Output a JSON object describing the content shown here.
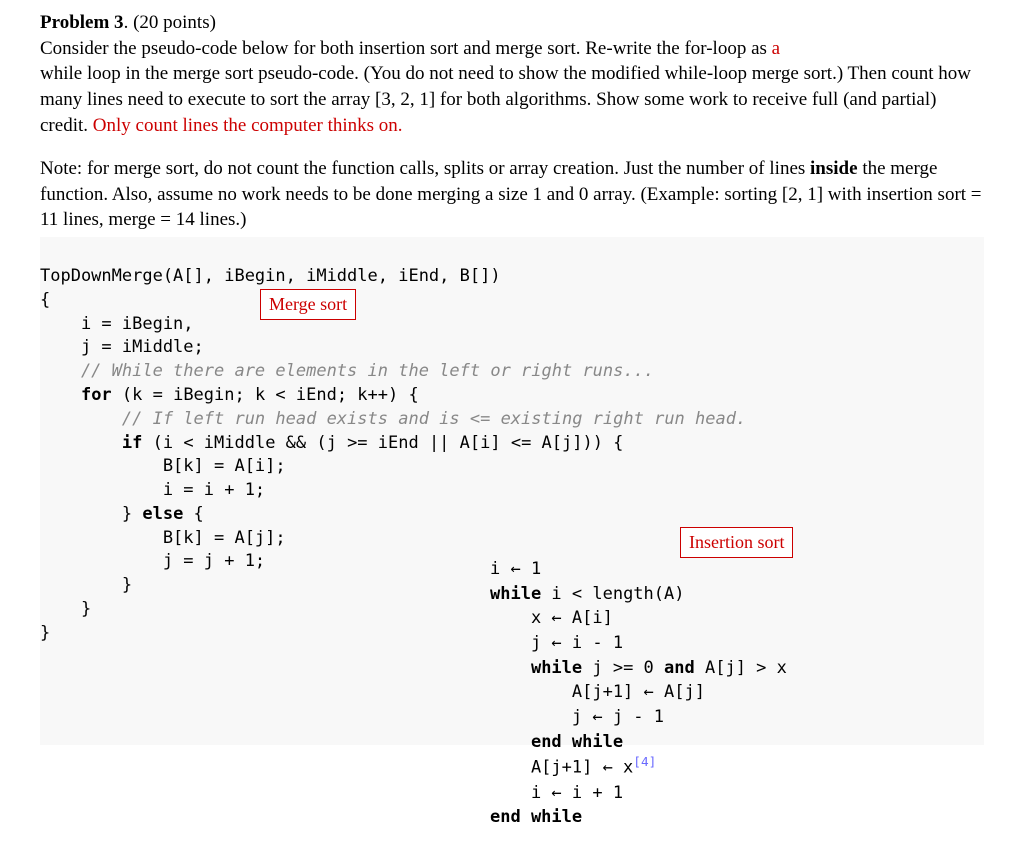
{
  "problem": {
    "title_bold": "Problem 3",
    "title_rest": ". (20 points)",
    "para1_a": "Consider the pseudo-code below for both insertion sort and merge sort.  Re-write the for-loop as ",
    "para1_red": "a",
    "para1_b": "while loop in the merge sort pseudo-code.  (You do not need to show the modified while-loop merge sort.)   Then count how many lines need to execute to sort the array [3, 2, 1] for both algorithms.  Show some work to receive full (and partial) credit.  ",
    "para1_red2": "Only count lines the computer thinks on.",
    "para2_a": "Note: for merge sort, do not count the function calls, splits or array creation.  Just the number of lines ",
    "para2_bold": "inside",
    "para2_b": " the merge function.  Also, assume no work needs to be done merging a size 1 and 0 array.  (Example: sorting [2, 1] with insertion sort = 11 lines, merge = 14 lines.)"
  },
  "annotations": {
    "merge_label": "Merge sort",
    "insertion_label": "Insertion sort"
  },
  "merge_code": {
    "l1": "TopDownMerge(A[], iBegin, iMiddle, iEnd, B[])",
    "l2": "{",
    "l3": "    i = iBegin,",
    "l4": "    j = iMiddle;",
    "l5": "    // While there are elements in the left or right runs...",
    "l6a": "    ",
    "l6_for": "for",
    "l6b": " (k = iBegin; k < iEnd; k++) {",
    "l7": "        // If left run head exists and is <= existing right run head.",
    "l8a": "        ",
    "l8_if": "if",
    "l8b": " (i < iMiddle && (j >= iEnd || A[i] <= A[j])) {",
    "l9": "            B[k] = A[i];",
    "l10": "            i = i + 1;",
    "l11a": "        } ",
    "l11_else": "else",
    "l11b": " {",
    "l12": "            B[k] = A[j];",
    "l13": "            j = j + 1;",
    "l14": "        }",
    "l15": "    }",
    "l16": "}"
  },
  "insertion_code": {
    "l1": "i ← 1",
    "l2a": "while",
    "l2b": " i < length(A)",
    "l3": "    x ← A[i]",
    "l4": "    j ← i - 1",
    "l5a": "    ",
    "l5_while": "while",
    "l5b": " j >= 0 ",
    "l5_and": "and",
    "l5c": " A[j] > x",
    "l6": "        A[j+1] ← A[j]",
    "l7": "        j ← j - 1",
    "l8a": "    ",
    "l8_end": "end while",
    "l9a": "    A[j+1] ← x",
    "l9_sup": "[4]",
    "l10": "    i ← i + 1",
    "l11": "end while"
  }
}
